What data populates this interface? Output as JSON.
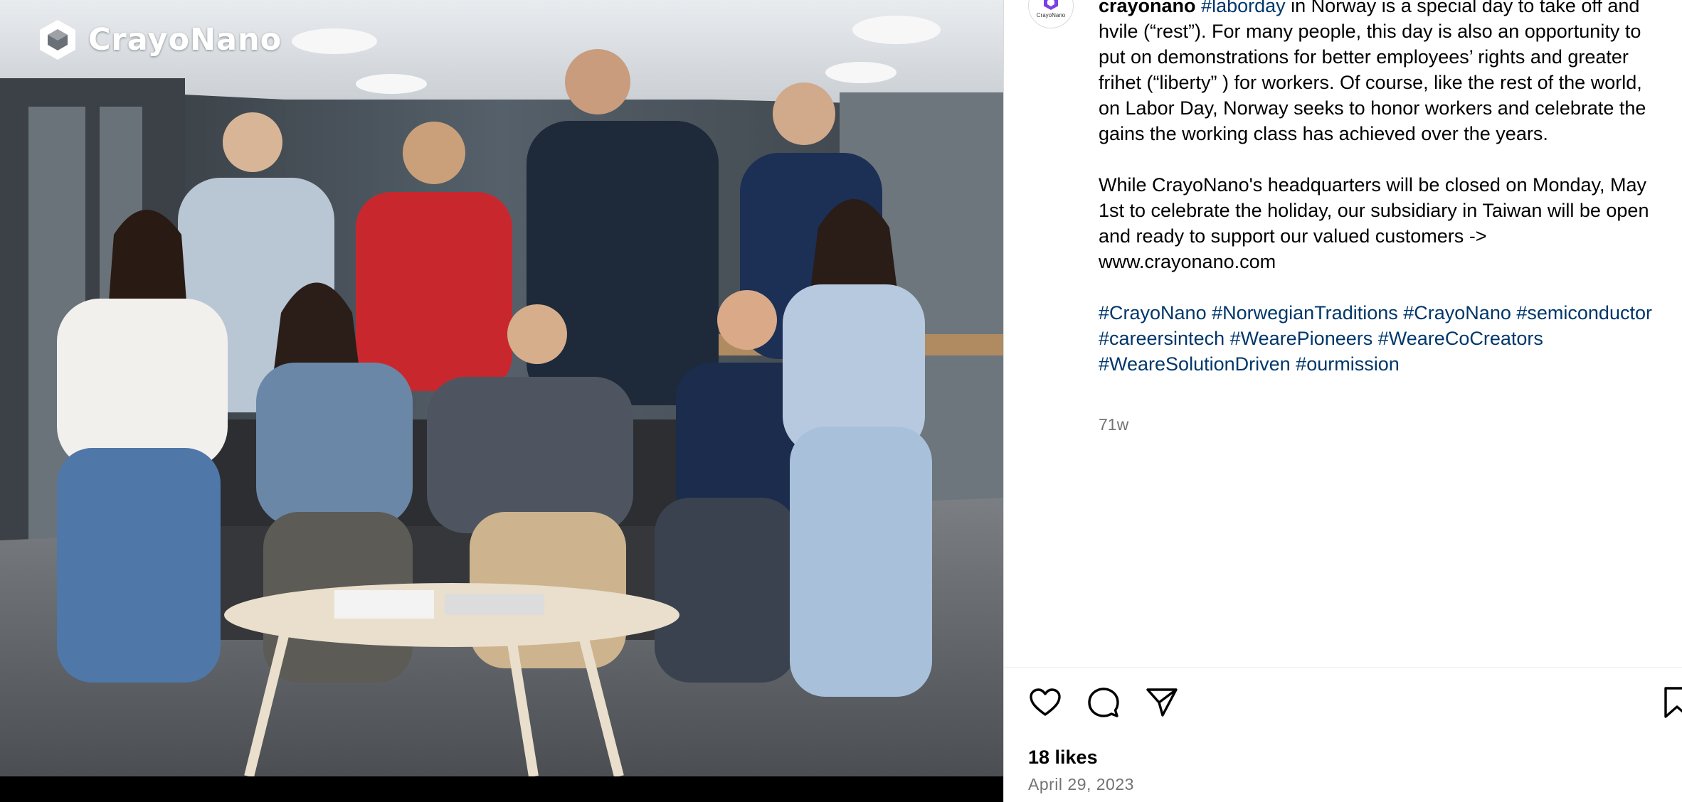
{
  "media": {
    "watermark_text": "CrayoNano"
  },
  "post": {
    "avatar_text": "CrayoNano",
    "username": "crayonano",
    "tag_laborday": "#laborday",
    "para1_text": " in Norway is a special day to take off and hvile (“rest”). For many people, this day is also an opportunity to put on demonstrations for better employees’ rights and greater frihet (“liberty” ) for workers. Of course, like the rest of the world, on Labor Day, Norway seeks to honor workers and celebrate the gains the working class has achieved over the years.",
    "para2_text": "While CrayoNano's headquarters will be closed on Monday, May 1st to celebrate the holiday, our subsidiary in Taiwan will be open and ready to support our valued customers -> www.crayonano.com",
    "hashtags": [
      "#CrayoNano",
      "#NorwegianTraditions",
      "#CrayoNano",
      "#semiconductor",
      "#careersintech",
      "#WearePioneers",
      "#WeareCoCreators",
      "#WeareSolutionDriven",
      "#ourmission"
    ],
    "age": "71w",
    "likes": "18 likes",
    "date": "April 29, 2023"
  },
  "icons": {
    "like": "heart-icon",
    "comment": "comment-icon",
    "share": "paper-plane-icon",
    "save": "bookmark-icon"
  },
  "colors": {
    "hashtag": "#00376b",
    "muted": "#737373",
    "brand_purple": "#7b3fe4"
  }
}
